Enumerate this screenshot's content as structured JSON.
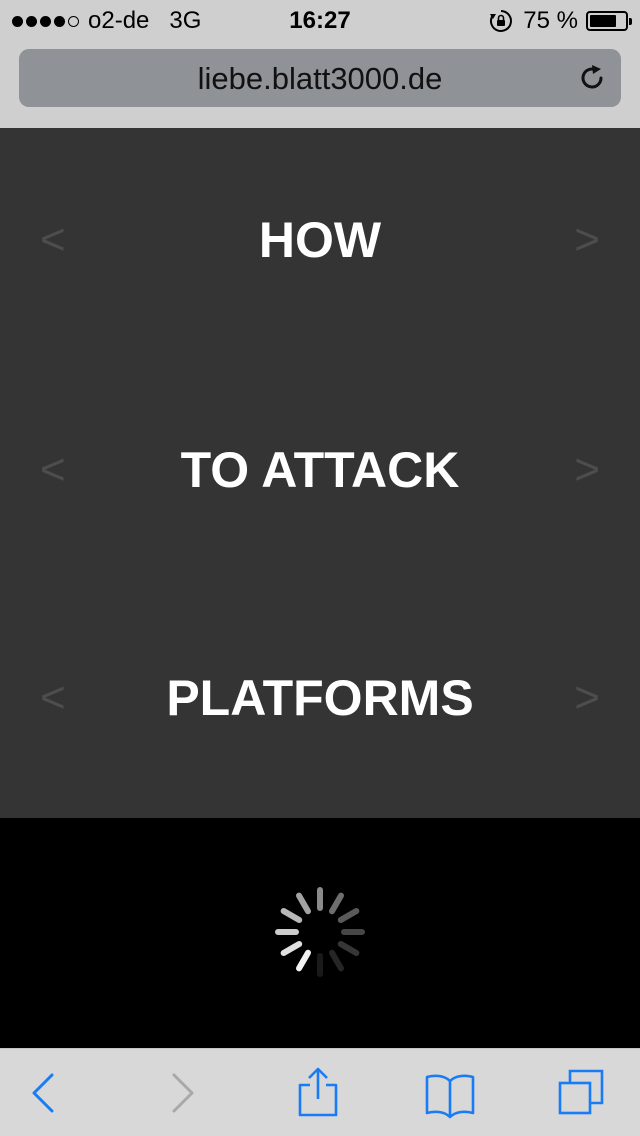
{
  "status_bar": {
    "carrier": "o2-de",
    "network": "3G",
    "time": "16:27",
    "battery_percent": "75 %",
    "battery_level": 0.75,
    "signal_bars_filled": 4,
    "signal_bars_total": 5
  },
  "browser": {
    "url": "liebe.blatt3000.de"
  },
  "content": {
    "rows": [
      {
        "prev": "<",
        "title": "HOW",
        "next": ">"
      },
      {
        "prev": "<",
        "title": "TO ATTACK",
        "next": ">"
      },
      {
        "prev": "<",
        "title": "PLATFORMS",
        "next": ">"
      }
    ]
  },
  "toolbar": {
    "items": [
      "back-icon",
      "forward-icon",
      "share-icon",
      "bookmarks-icon",
      "tabs-icon"
    ]
  },
  "colors": {
    "status_bg": "#cfcfcf",
    "url_bar_bg": "#8f9297",
    "content_bg": "#343434",
    "arrow": "#4d4d4d",
    "toolbar_accent": "#1a7cf5"
  }
}
